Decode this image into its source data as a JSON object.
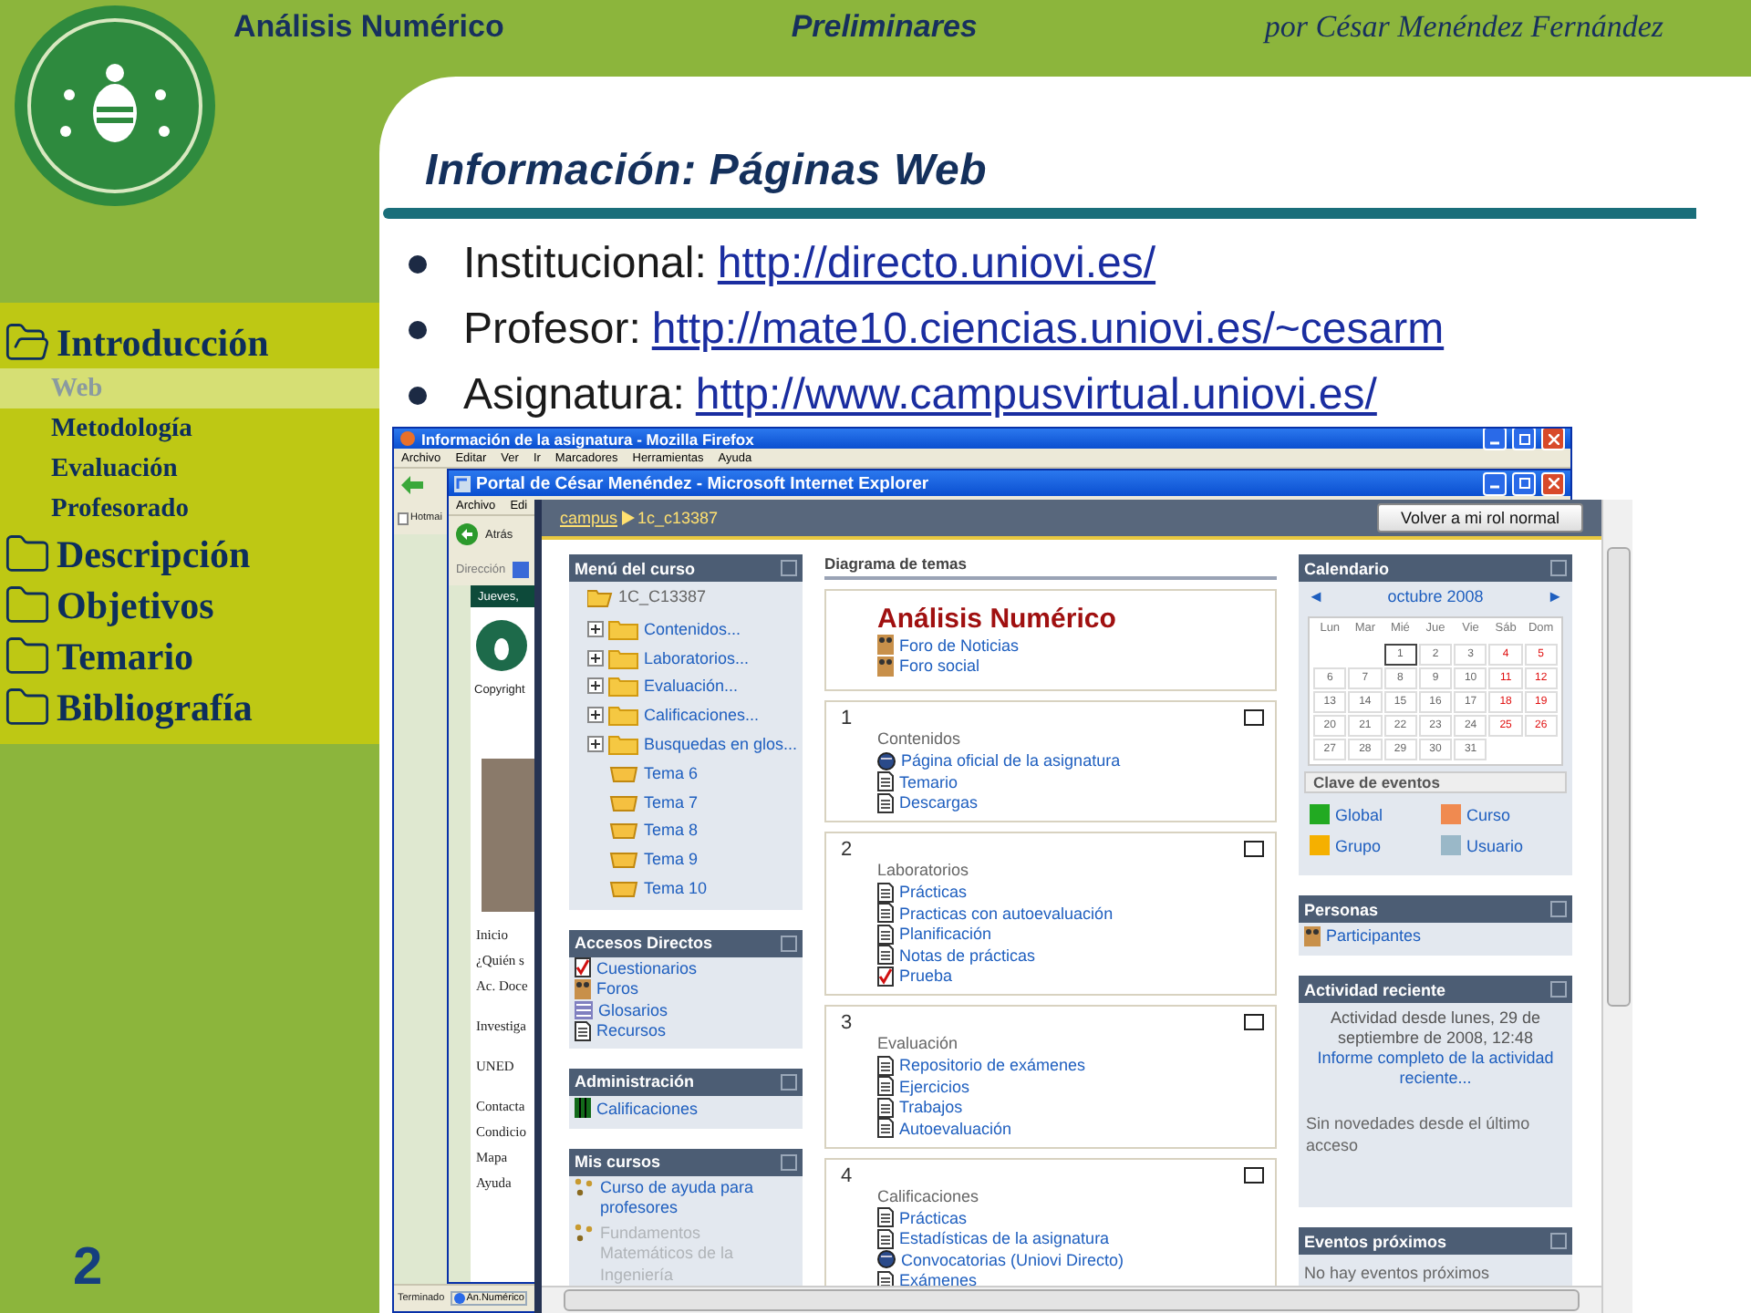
{
  "header": {
    "course": "Análisis Numérico",
    "chapter": "Preliminares",
    "author": "por César Menéndez Fernández"
  },
  "sidebar": {
    "items": [
      {
        "label": "Introducción",
        "expanded": true,
        "children": [
          {
            "label": "Web",
            "selected": true
          },
          {
            "label": "Metodología",
            "selected": false
          },
          {
            "label": "Evaluación",
            "selected": false
          },
          {
            "label": "Profesorado",
            "selected": false
          }
        ]
      },
      {
        "label": "Descripción",
        "expanded": false
      },
      {
        "label": "Objetivos",
        "expanded": false
      },
      {
        "label": "Temario",
        "expanded": false
      },
      {
        "label": "Bibliografía",
        "expanded": false
      }
    ]
  },
  "slide_number": "2",
  "title": "Información: Páginas Web",
  "bullets": [
    {
      "label": "Institucional:",
      "link": "http://directo.uniovi.es/"
    },
    {
      "label": "Profesor:",
      "link": "http://mate10.ciencias.uniovi.es/~cesarm"
    },
    {
      "label": "Asignatura:",
      "link": "http://www.campusvirtual.uniovi.es/"
    }
  ],
  "firefox": {
    "title": "Información de la asignatura - Mozilla Firefox",
    "menu": [
      "Archivo",
      "Editar",
      "Ver",
      "Ir",
      "Marcadores",
      "Herramientas",
      "Ayuda"
    ],
    "bookmark": "Hotmai",
    "status": "Terminado",
    "taskbar_item": "An.Numérico"
  },
  "explorer": {
    "title": "Portal de César Menéndez - Microsoft Internet Explorer",
    "menu": [
      "Archivo",
      "Edi"
    ],
    "back": "Atrás",
    "address_label": "Dirección",
    "banner": "Jueves,",
    "copyright": "Copyright",
    "links": [
      "Inicio",
      "¿Quién s",
      "Ac. Doce",
      "Investiga",
      "UNED",
      "Contacta",
      "Condicio",
      "Mapa",
      "Ayuda"
    ]
  },
  "moodle": {
    "breadcrumb": {
      "link": "campus",
      "current": "1c_c13387"
    },
    "role_button": "Volver a mi rol normal",
    "course_menu": {
      "title": "Menú del curso",
      "root": "1C_C13387",
      "items": [
        {
          "label": "Contenidos...",
          "kind": "folder"
        },
        {
          "label": "Laboratorios...",
          "kind": "folder"
        },
        {
          "label": "Evaluación...",
          "kind": "folder"
        },
        {
          "label": "Calificaciones...",
          "kind": "folder"
        },
        {
          "label": "Busquedas en glos...",
          "kind": "folder"
        },
        {
          "label": "Tema 6",
          "kind": "topic"
        },
        {
          "label": "Tema 7",
          "kind": "topic"
        },
        {
          "label": "Tema 8",
          "kind": "topic"
        },
        {
          "label": "Tema 9",
          "kind": "topic"
        },
        {
          "label": "Tema 10",
          "kind": "topic"
        }
      ]
    },
    "shortcuts": {
      "title": "Accesos Directos",
      "items": [
        {
          "label": "Cuestionarios",
          "kind": "quiz"
        },
        {
          "label": "Foros",
          "kind": "forum"
        },
        {
          "label": "Glosarios",
          "kind": "glossary"
        },
        {
          "label": "Recursos",
          "kind": "resource"
        }
      ]
    },
    "admin": {
      "title": "Administración",
      "items": [
        {
          "label": "Calificaciones",
          "kind": "grades"
        }
      ]
    },
    "my_courses": {
      "title": "Mis cursos",
      "items": [
        {
          "label": "Curso de ayuda para profesores",
          "disabled": false
        },
        {
          "label": "Fundamentos Matemáticos de la Ingeniería",
          "disabled": true
        }
      ]
    },
    "topics": {
      "title": "Diagrama de temas",
      "course_title": "Análisis Numérico",
      "forums": [
        "Foro de Noticias",
        "Foro social"
      ],
      "sections": [
        {
          "number": "1",
          "summary": "Contenidos",
          "links": [
            {
              "label": "Página oficial de la asignatura",
              "kind": "url"
            },
            {
              "label": "Temario",
              "kind": "resource"
            },
            {
              "label": "Descargas",
              "kind": "resource"
            }
          ]
        },
        {
          "number": "2",
          "summary": "Laboratorios",
          "links": [
            {
              "label": "Prácticas",
              "kind": "resource"
            },
            {
              "label": "Practicas con autoevaluación",
              "kind": "resource"
            },
            {
              "label": "Planificación",
              "kind": "resource"
            },
            {
              "label": "Notas de prácticas",
              "kind": "resource"
            },
            {
              "label": "Prueba",
              "kind": "quiz"
            }
          ]
        },
        {
          "number": "3",
          "summary": "Evaluación",
          "links": [
            {
              "label": "Repositorio de exámenes",
              "kind": "resource"
            },
            {
              "label": "Ejercicios",
              "kind": "resource"
            },
            {
              "label": "Trabajos",
              "kind": "resource"
            },
            {
              "label": "Autoevaluación",
              "kind": "resource"
            }
          ]
        },
        {
          "number": "4",
          "summary": "Calificaciones",
          "links": [
            {
              "label": "Prácticas",
              "kind": "resource"
            },
            {
              "label": "Estadísticas de la asignatura",
              "kind": "resource"
            },
            {
              "label": "Convocatorias (Uniovi Directo)",
              "kind": "url"
            },
            {
              "label": "Exámenes",
              "kind": "resource"
            }
          ]
        }
      ]
    },
    "calendar": {
      "title": "Calendario",
      "prev": "◄",
      "month": "octubre 2008",
      "next": "►",
      "weekdays": [
        "Lun",
        "Mar",
        "Mié",
        "Jue",
        "Vie",
        "Sáb",
        "Dom"
      ],
      "weeks": [
        [
          {
            "kind": "blank"
          },
          {
            "kind": "blank"
          },
          {
            "kind": "day",
            "day": "1",
            "today": true
          },
          {
            "kind": "day",
            "day": "2",
            "today": false
          },
          {
            "kind": "day",
            "day": "3",
            "today": false
          },
          {
            "kind": "day",
            "day": "4",
            "today": false
          },
          {
            "kind": "day",
            "day": "5",
            "today": false
          }
        ],
        [
          {
            "kind": "day",
            "day": "6",
            "today": false
          },
          {
            "kind": "day",
            "day": "7",
            "today": false
          },
          {
            "kind": "day",
            "day": "8",
            "today": false
          },
          {
            "kind": "day",
            "day": "9",
            "today": false
          },
          {
            "kind": "day",
            "day": "10",
            "today": false
          },
          {
            "kind": "day",
            "day": "11",
            "today": false
          },
          {
            "kind": "day",
            "day": "12",
            "today": false
          }
        ],
        [
          {
            "kind": "day",
            "day": "13",
            "today": false
          },
          {
            "kind": "day",
            "day": "14",
            "today": false
          },
          {
            "kind": "day",
            "day": "15",
            "today": false
          },
          {
            "kind": "day",
            "day": "16",
            "today": false
          },
          {
            "kind": "day",
            "day": "17",
            "today": false
          },
          {
            "kind": "day",
            "day": "18",
            "today": false
          },
          {
            "kind": "day",
            "day": "19",
            "today": false
          }
        ],
        [
          {
            "kind": "day",
            "day": "20",
            "today": false
          },
          {
            "kind": "day",
            "day": "21",
            "today": false
          },
          {
            "kind": "day",
            "day": "22",
            "today": false
          },
          {
            "kind": "day",
            "day": "23",
            "today": false
          },
          {
            "kind": "day",
            "day": "24",
            "today": false
          },
          {
            "kind": "day",
            "day": "25",
            "today": false
          },
          {
            "kind": "day",
            "day": "26",
            "today": false
          }
        ],
        [
          {
            "kind": "day",
            "day": "27",
            "today": false
          },
          {
            "kind": "day",
            "day": "28",
            "today": false
          },
          {
            "kind": "day",
            "day": "29",
            "today": false
          },
          {
            "kind": "day",
            "day": "30",
            "today": false
          },
          {
            "kind": "day",
            "day": "31",
            "today": false
          },
          {
            "kind": "blank"
          },
          {
            "kind": "blank"
          }
        ]
      ],
      "legend_title": "Clave de eventos",
      "legend": [
        {
          "label": "Global",
          "color": "#22aa22"
        },
        {
          "label": "Curso",
          "color": "#f08a50"
        },
        {
          "label": "Grupo",
          "color": "#f5b000"
        },
        {
          "label": "Usuario",
          "color": "#9ab8c8"
        }
      ]
    },
    "people": {
      "title": "Personas",
      "items": [
        "Participantes"
      ]
    },
    "recent": {
      "title": "Actividad reciente",
      "since": "Actividad desde lunes, 29 de septiembre de 2008, 12:48",
      "report_link": "Informe completo de la actividad reciente...",
      "note": "Sin novedades desde el último acceso"
    },
    "upcoming": {
      "title": "Eventos próximos",
      "note": "No hay eventos próximos"
    }
  }
}
